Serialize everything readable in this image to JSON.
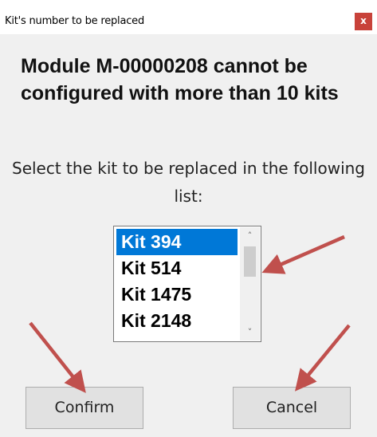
{
  "dialog": {
    "title": "Kit's number to be replaced",
    "close_glyph": "x",
    "headline": "Module M-00000208 cannot be configured with more than 10 kits",
    "instructions": "Select the kit to be replaced in the following list:"
  },
  "kit_list": {
    "items": [
      "Kit 394",
      "Kit 514",
      "Kit 1475",
      "Kit 2148"
    ],
    "selected": "Kit 394"
  },
  "buttons": {
    "confirm_label": "Confirm",
    "cancel_label": "Cancel"
  },
  "colors": {
    "close_bg": "#c8423a",
    "selection": "#0078d7",
    "annotation_arrow": "#c0504d",
    "dialog_bg": "#f0f0f0"
  },
  "icons": [
    "close-icon",
    "scroll-up-icon",
    "scroll-down-icon",
    "annotation-arrow"
  ]
}
